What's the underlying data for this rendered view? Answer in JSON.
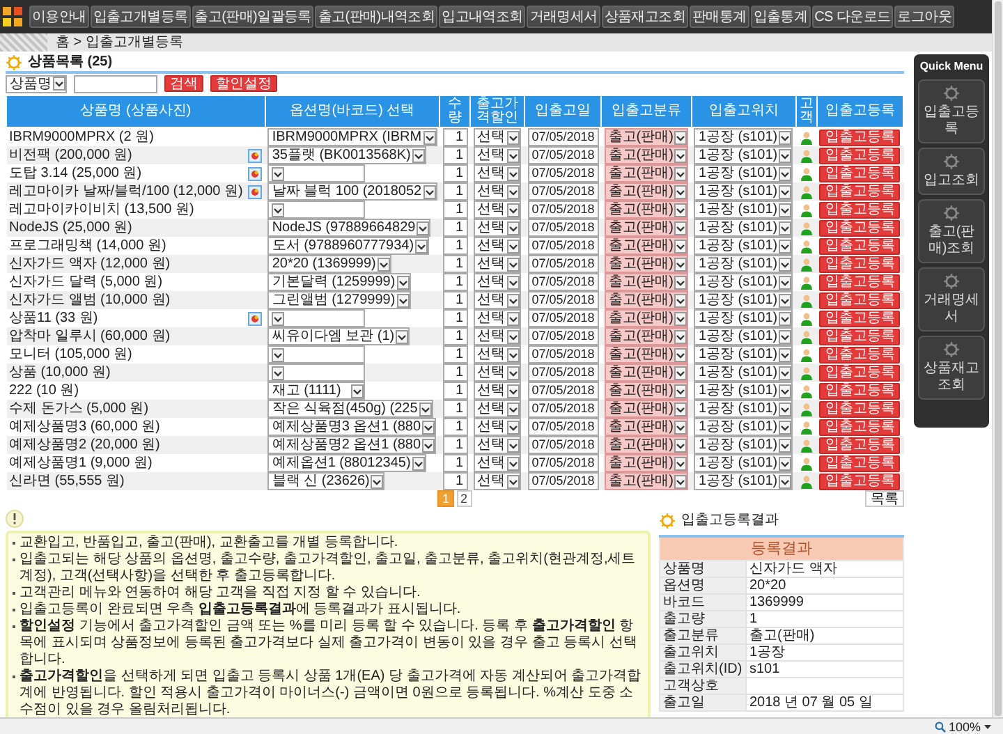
{
  "nav": {
    "items": [
      "이용안내",
      "입출고개별등록",
      "출고(판매)일괄등록",
      "출고(판매)내역조회",
      "입고내역조회",
      "거래명세서",
      "상품재고조회",
      "판매통계",
      "입출통계",
      "CS 다운로드",
      "로그아웃"
    ]
  },
  "breadcrumb": "홈 > 입출고개별등록",
  "product_list": {
    "title": "상품목록 (25)",
    "search": {
      "field": "상품명",
      "button": "검색",
      "discount_button": "할인설정"
    },
    "columns": [
      "상품명 (상품사진)",
      "옵션명(바코드) 선택",
      "수량",
      "출고가격할인",
      "입출고일",
      "입출고분류",
      "입출고위치",
      "고객",
      "입출고등록"
    ],
    "rows": [
      {
        "name": "IBRM9000MPRX (2 원)",
        "photo": false,
        "option": "IBRM9000MPRX (IBRM",
        "quantity": "1",
        "discount": "선택",
        "date": "07/05/2018",
        "category": "출고(판매)",
        "location": "1공장 (s101)",
        "button": "입출고등록"
      },
      {
        "name": "비전팩 (200,000 원)",
        "photo": true,
        "option": "35플랫 (BK0013568K)",
        "quantity": "1",
        "discount": "선택",
        "date": "07/05/2018",
        "category": "출고(판매)",
        "location": "1공장 (s101)",
        "button": "입출고등록"
      },
      {
        "name": "도탑 3.14 (25,000 원)",
        "photo": true,
        "quantity": "1",
        "discount": "선택",
        "date": "07/05/2018",
        "category": "출고(판매)",
        "location": "1공장 (s101)",
        "button": "입출고등록"
      },
      {
        "name": "레고마이카 날짜/블럭/100 (12,000 원)",
        "photo": true,
        "option": "날짜 블럭 100 (2018052",
        "quantity": "1",
        "discount": "선택",
        "date": "07/05/2018",
        "category": "출고(판매)",
        "location": "1공장 (s101)",
        "button": "입출고등록"
      },
      {
        "name": "레고마이카이비치 (13,500 원)",
        "photo": false,
        "quantity": "1",
        "discount": "선택",
        "date": "07/05/2018",
        "category": "출고(판매)",
        "location": "1공장 (s101)",
        "button": "입출고등록"
      },
      {
        "name": "NodeJS (25,000 원)",
        "photo": false,
        "option": "NodeJS (97889664829",
        "quantity": "1",
        "discount": "선택",
        "date": "07/05/2018",
        "category": "출고(판매)",
        "location": "1공장 (s101)",
        "button": "입출고등록"
      },
      {
        "name": "프로그래밍책 (14,000 원)",
        "photo": false,
        "option": "도서 (9788960777934)",
        "quantity": "1",
        "discount": "선택",
        "date": "07/05/2018",
        "category": "출고(판매)",
        "location": "1공장 (s101)",
        "button": "입출고등록"
      },
      {
        "name": "신자가드 액자 (12,000 원)",
        "photo": false,
        "option": "20*20 (1369999)",
        "quantity": "1",
        "discount": "선택",
        "date": "07/05/2018",
        "category": "출고(판매)",
        "location": "1공장 (s101)",
        "button": "입출고등록"
      },
      {
        "name": "신자가드 달력 (5,000 원)",
        "photo": false,
        "option": "기본달력 (1259999)",
        "quantity": "1",
        "discount": "선택",
        "date": "07/05/2018",
        "category": "출고(판매)",
        "location": "1공장 (s101)",
        "button": "입출고등록"
      },
      {
        "name": "신자가드 앨범 (10,000 원)",
        "photo": false,
        "option": "그린앨범 (1279999)",
        "quantity": "1",
        "discount": "선택",
        "date": "07/05/2018",
        "category": "출고(판매)",
        "location": "1공장 (s101)",
        "button": "입출고등록"
      },
      {
        "name": "상품11 (33 원)",
        "photo": true,
        "quantity": "1",
        "discount": "선택",
        "date": "07/05/2018",
        "category": "출고(판매)",
        "location": "1공장 (s101)",
        "button": "입출고등록"
      },
      {
        "name": "압착마 일루시 (60,000 원)",
        "photo": false,
        "option": "씨유이다엠 보관 (1)",
        "quantity": "1",
        "discount": "선택",
        "date": "07/05/2018",
        "category": "출고(판매)",
        "location": "1공장 (s101)",
        "button": "입출고등록"
      },
      {
        "name": "모니터 (105,000 원)",
        "photo": false,
        "quantity": "1",
        "discount": "선택",
        "date": "07/05/2018",
        "category": "출고(판매)",
        "location": "1공장 (s101)",
        "button": "입출고등록"
      },
      {
        "name": "상품 (10,000 원)",
        "photo": false,
        "quantity": "1",
        "discount": "선택",
        "date": "07/05/2018",
        "category": "출고(판매)",
        "location": "1공장 (s101)",
        "button": "입출고등록"
      },
      {
        "name": "222 (10 원)",
        "photo": false,
        "option": "재고 (1111)",
        "quantity": "1",
        "discount": "선택",
        "date": "07/05/2018",
        "category": "출고(판매)",
        "location": "1공장 (s101)",
        "button": "입출고등록"
      },
      {
        "name": "수제 돈가스 (5,000 원)",
        "photo": false,
        "option": "작은 식육점(450g) (225",
        "quantity": "1",
        "discount": "선택",
        "date": "07/05/2018",
        "category": "출고(판매)",
        "location": "1공장 (s101)",
        "button": "입출고등록"
      },
      {
        "name": "예제상품명3 (60,000 원)",
        "photo": false,
        "option": "예제상품명3 옵션1 (880",
        "quantity": "1",
        "discount": "선택",
        "date": "07/05/2018",
        "category": "출고(판매)",
        "location": "1공장 (s101)",
        "button": "입출고등록"
      },
      {
        "name": "예제상품명2 (20,000 원)",
        "photo": false,
        "option": "예제상품명2 옵션1 (880",
        "quantity": "1",
        "discount": "선택",
        "date": "07/05/2018",
        "category": "출고(판매)",
        "location": "1공장 (s101)",
        "button": "입출고등록"
      },
      {
        "name": "예제상품명1 (9,000 원)",
        "photo": false,
        "option": "예제옵션1 (88012345)",
        "quantity": "1",
        "discount": "선택",
        "date": "07/05/2018",
        "category": "출고(판매)",
        "location": "1공장 (s101)",
        "button": "입출고등록"
      },
      {
        "name": "신라면 (55,555 원)",
        "photo": false,
        "option": "블랙 신 (23626)",
        "quantity": "1",
        "discount": "선택",
        "date": "07/05/2018",
        "category": "출고(판매)",
        "location": "1공장 (s101)",
        "button": "입출고등록"
      }
    ],
    "pagination": [
      {
        "label": "1",
        "selected": true
      },
      {
        "label": "2",
        "selected": false
      }
    ],
    "list_button": "목록"
  },
  "result": {
    "title": "입출고등록결과",
    "heading": "등록결과",
    "rows": [
      {
        "label": "상품명",
        "value": "신자가드 액자"
      },
      {
        "label": "옵션명",
        "value": "20*20"
      },
      {
        "label": "바코드",
        "value": "1369999"
      },
      {
        "label": "출고량",
        "value": "1"
      },
      {
        "label": "출고분류",
        "value": "출고(판매)"
      },
      {
        "label": "출고위치",
        "value": "1공장"
      },
      {
        "label": "출고위치(ID)",
        "value": "s101"
      },
      {
        "label": "고객상호"
      },
      {
        "label": "출고일",
        "value": "2018 년 07 월 05 일"
      }
    ]
  },
  "quick_menu": {
    "title": "Quick Menu",
    "items": [
      "입출고등록",
      "입고조회",
      "출고(판매)조회",
      "거래명세서",
      "상품재고조회"
    ]
  },
  "notes": [
    "교환입고, 반품입고, 출고(판매), 교환출고를 개별 등록합니다.",
    "입출고되는 해당 상품의 옵션명, 출고수량, 출고가격할인, 출고일, 출고분류, 출고위치(현관계정,세트계정), 고객(선택사항)을 선택한 후 출고등록합니다.",
    "고객관리 메뉴와 연동하여 해당 고객을 직접 지정 할 수 있습니다.",
    "입출고등록이 완료되면 우측 **입출고등록결과**에 등록결과가 표시됩니다.",
    "**할인설정** 기능에서 출고가격할인 금액 또는 %를 미리 등록 할 수 있습니다. 등록 후 **출고가격할인** 항목에 표시되며 상품정보에 등록된 출고가격보다 실제 출고가격이 변동이 있을 경우 출고 등록시 선택합니다.",
    "**출고가격할인**을 선택하게 되면 입출고 등록시 상품 1개(EA) 당 출고가격에 자동 계산되어 출고가격합계에 반영됩니다. 할인 적용시 출고가격이 마이너스(-) 금액이면 0원으로 등록됩니다. %계산 도중 소수점이 있을 경우 올림처리됩니다."
  ],
  "status_bar": {
    "zoom": "100%"
  }
}
